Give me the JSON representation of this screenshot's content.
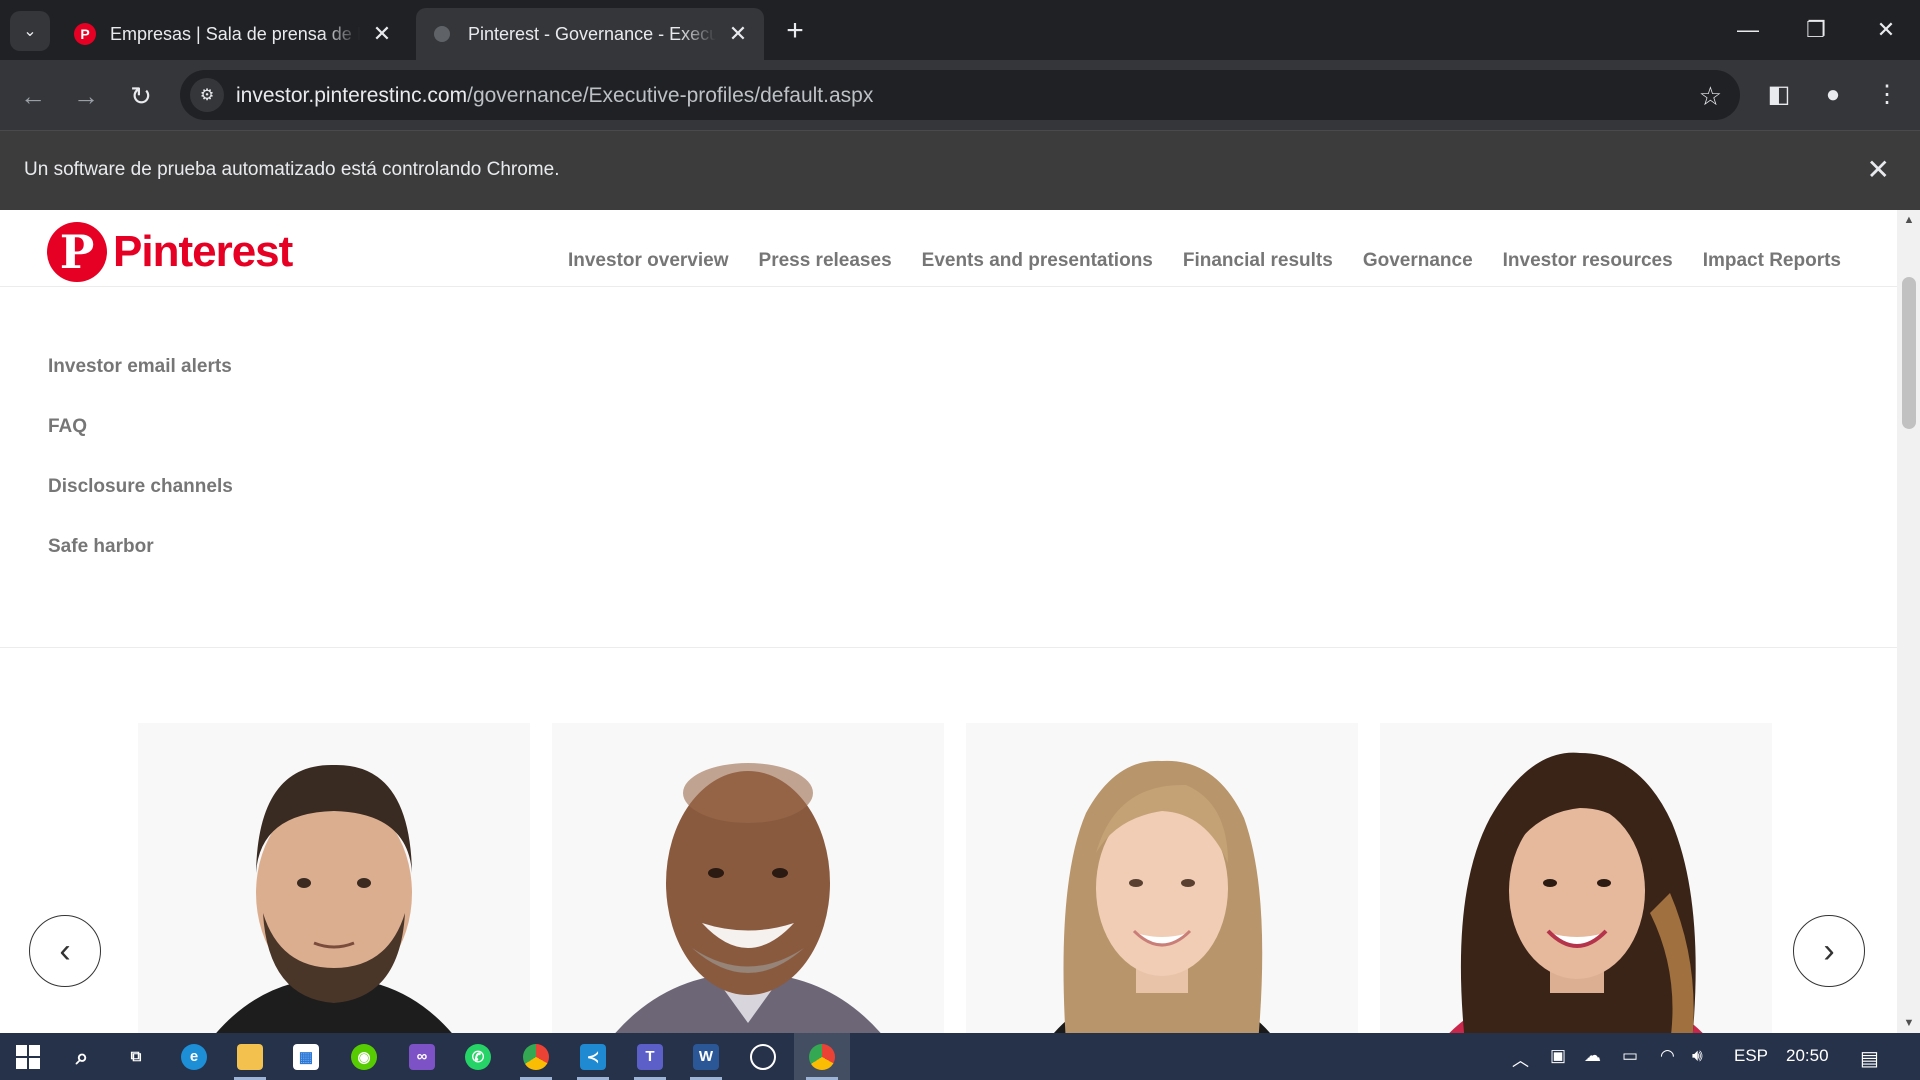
{
  "browser": {
    "tabs": [
      {
        "title": "Empresas | Sala de prensa de P",
        "favicon": "pinterest-favicon",
        "active": false
      },
      {
        "title": "Pinterest - Governance - Execu",
        "favicon": "globe-favicon",
        "active": true
      }
    ],
    "url_host": "investor.pinterestinc.com",
    "url_path": "/governance/Executive-profiles/default.aspx",
    "infobar_message": "Un software de prueba automatizado está controlando Chrome.",
    "accent": "#202124"
  },
  "site": {
    "logo_text": "Pinterest",
    "brand_color": "#e60023",
    "nav": [
      "Investor overview",
      "Press releases",
      "Events and presentations",
      "Financial results",
      "Governance",
      "Investor resources",
      "Impact Reports"
    ],
    "subnav": [
      "Investor email alerts",
      "FAQ",
      "Disclosure channels",
      "Safe harbor"
    ]
  },
  "carousel": {
    "profiles": [
      {
        "portrait": "man-beard-dark-hair"
      },
      {
        "portrait": "man-bald-smiling"
      },
      {
        "portrait": "woman-blonde-hair"
      },
      {
        "portrait": "woman-dark-wavy-hair"
      }
    ],
    "prev_icon": "chevron-left-icon",
    "next_icon": "chevron-right-icon"
  },
  "taskbar": {
    "apps": [
      "start",
      "search",
      "task-view",
      "edge",
      "file-explorer",
      "store",
      "duolingo",
      "visual-studio",
      "whatsapp",
      "chrome",
      "vscode",
      "teams",
      "word",
      "obs",
      "chrome-automated"
    ],
    "language": "ESP",
    "time": "20:50"
  }
}
